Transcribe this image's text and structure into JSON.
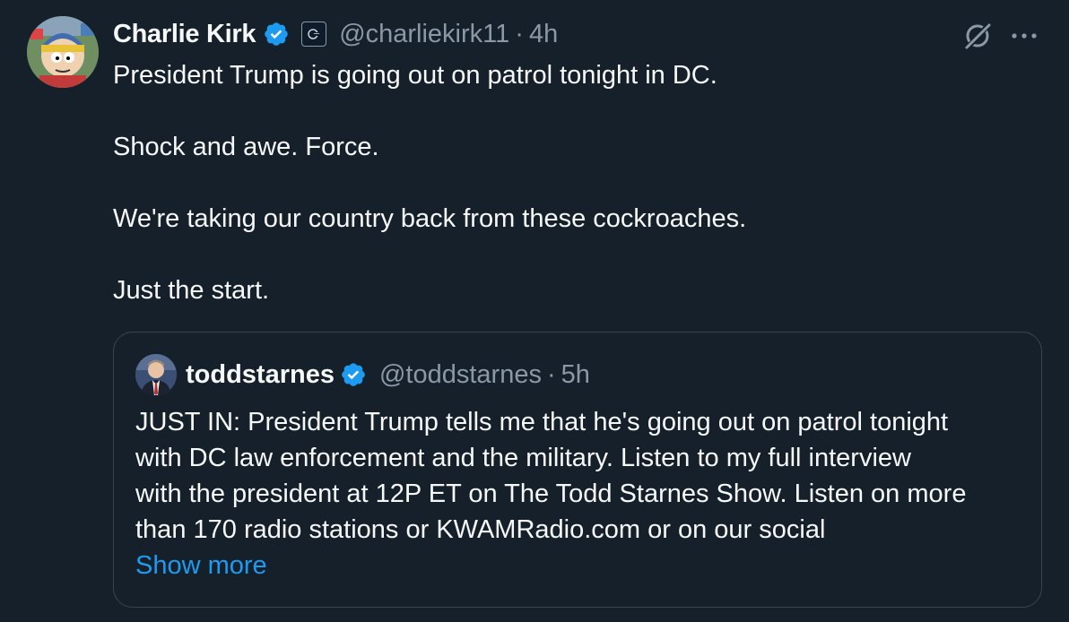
{
  "tweet": {
    "author": {
      "display_name": "Charlie Kirk",
      "handle": "@charliekirk11",
      "avatar_icon": "cartoon-avatar-icon",
      "verified_icon": "verified-badge-icon",
      "affiliation_icon": "affiliation-badge-icon"
    },
    "dot": "·",
    "time": "4h",
    "actions": {
      "grok_icon": "grok-icon",
      "more_icon": "more-icon"
    },
    "lines": [
      "President Trump is going out on patrol tonight in DC.",
      "",
      "Shock and awe. Force.",
      "",
      "We're taking our country back from these cockroaches.",
      "",
      "Just the start."
    ]
  },
  "quote": {
    "author": {
      "display_name": "toddstarnes",
      "handle": "@toddstarnes",
      "avatar_icon": "person-avatar-icon",
      "verified_icon": "verified-badge-icon"
    },
    "dot": "·",
    "time": "5h",
    "lines": [
      "JUST IN: President Trump tells me that he's going out on patrol tonight",
      "with DC law enforcement and the military. Listen to my full interview",
      "with the president at 12P ET on The Todd Starnes Show. Listen on more",
      "than 170 radio stations or KWAMRadio.com or on our social"
    ],
    "show_more": "Show more"
  },
  "colors": {
    "background": "#15202b",
    "text": "#f7f9f9",
    "secondary": "#8b98a5",
    "accent": "#1d9bf0",
    "border": "#38444d"
  }
}
